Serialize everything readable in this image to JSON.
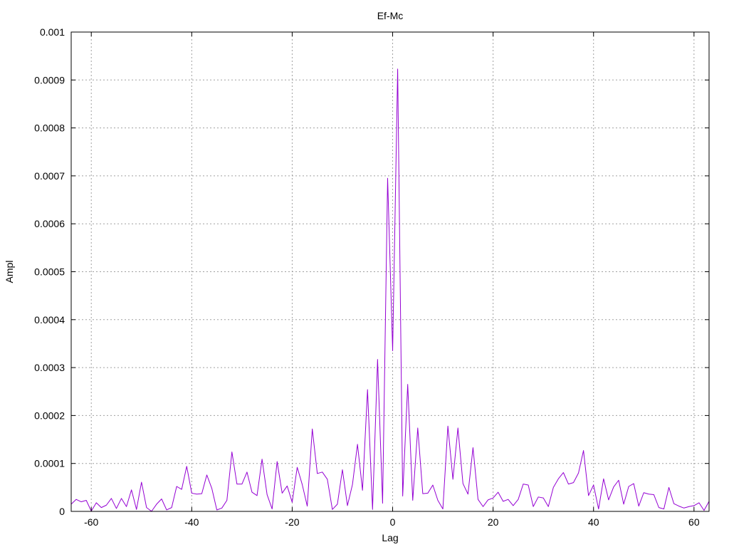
{
  "chart_data": {
    "type": "line",
    "title": "Ef-Mc",
    "xlabel": "Lag",
    "ylabel": "Ampl",
    "xlim": [
      -64,
      63
    ],
    "ylim": [
      0,
      0.001
    ],
    "grid": true,
    "x_ticks": [
      -60,
      -40,
      -20,
      0,
      20,
      40,
      60
    ],
    "x_tick_labels": [
      "-60",
      "-40",
      "-20",
      "0",
      "20",
      "40",
      "60"
    ],
    "y_ticks": [
      0,
      0.0001,
      0.0002,
      0.0003,
      0.0004,
      0.0005,
      0.0006,
      0.0007,
      0.0008,
      0.0009,
      0.001
    ],
    "y_tick_labels": [
      "0",
      "0.0001",
      "0.0002",
      "0.0003",
      "0.0004",
      "0.0005",
      "0.0006",
      "0.0007",
      "0.0008",
      "0.0009",
      "0.001"
    ],
    "series": [
      {
        "color": "#9400d3",
        "x": [
          -64,
          -63,
          -62,
          -61,
          -60,
          -59,
          -58,
          -57,
          -56,
          -55,
          -54,
          -53,
          -52,
          -51,
          -50,
          -49,
          -48,
          -47,
          -46,
          -45,
          -44,
          -43,
          -42,
          -41,
          -40,
          -39,
          -38,
          -37,
          -36,
          -35,
          -34,
          -33,
          -32,
          -31,
          -30,
          -29,
          -28,
          -27,
          -26,
          -25,
          -24,
          -23,
          -22,
          -21,
          -20,
          -19,
          -18,
          -17,
          -16,
          -15,
          -14,
          -13,
          -12,
          -11,
          -10,
          -9,
          -8,
          -7,
          -6,
          -5,
          -4,
          -3,
          -2,
          -1,
          0,
          1,
          2,
          3,
          4,
          5,
          6,
          7,
          8,
          9,
          10,
          11,
          12,
          13,
          14,
          15,
          16,
          17,
          18,
          19,
          20,
          21,
          22,
          23,
          24,
          25,
          26,
          27,
          28,
          29,
          30,
          31,
          32,
          33,
          34,
          35,
          36,
          37,
          38,
          39,
          40,
          41,
          42,
          43,
          44,
          45,
          46,
          47,
          48,
          49,
          50,
          51,
          52,
          53,
          54,
          55,
          56,
          57,
          58,
          59,
          60,
          61,
          62,
          63
        ],
        "y": [
          1.5e-05,
          2.5e-05,
          2e-05,
          2.3e-05,
          5e-07,
          1.8e-05,
          8e-06,
          1.3e-05,
          2.7e-05,
          6e-06,
          2.7e-05,
          1e-05,
          4.5e-05,
          4e-06,
          6.1e-05,
          8e-06,
          2e-07,
          1.5e-05,
          2.6e-05,
          3e-06,
          8e-06,
          5.2e-05,
          4.6e-05,
          9.4e-05,
          3.8e-05,
          3.6e-05,
          3.7e-05,
          7.6e-05,
          4.8e-05,
          3e-06,
          7e-06,
          2.3e-05,
          0.000124,
          5.7e-05,
          5.7e-05,
          8.2e-05,
          4e-05,
          3.3e-05,
          0.000109,
          3.5e-05,
          5e-06,
          0.000104,
          3.8e-05,
          5.3e-05,
          1.9e-05,
          9.2e-05,
          5.6e-05,
          1.1e-05,
          0.000172,
          7.9e-05,
          8.2e-05,
          6.7e-05,
          4e-06,
          1.5e-05,
          8.7e-05,
          1.2e-05,
          5.6e-05,
          0.00014,
          4.4e-05,
          0.000254,
          4e-06,
          0.000317,
          1.7e-05,
          0.000695,
          0.000335,
          0.000923,
          3.2e-05,
          0.000265,
          2.3e-05,
          0.000174,
          3.7e-05,
          3.8e-05,
          5.5e-05,
          2.3e-05,
          5e-06,
          0.000178,
          6.7e-05,
          0.000174,
          5.8e-05,
          3.6e-05,
          0.000133,
          2.5e-05,
          1e-05,
          2.4e-05,
          2.8e-05,
          4e-05,
          2.1e-05,
          2.5e-05,
          1.2e-05,
          2.5e-05,
          5.7e-05,
          5.5e-05,
          1e-05,
          3e-05,
          2.8e-05,
          1e-05,
          5e-05,
          6.8e-05,
          8.1e-05,
          5.7e-05,
          6e-05,
          8e-05,
          0.000127,
          3.3e-05,
          5.5e-05,
          5e-06,
          6.8e-05,
          2.4e-05,
          5.1e-05,
          6.5e-05,
          1.5e-05,
          5.2e-05,
          5.8e-05,
          1.1e-05,
          3.9e-05,
          3.6e-05,
          3.5e-05,
          8e-06,
          5e-06,
          5e-05,
          1.6e-05,
          1.1e-05,
          7e-06,
          1e-05,
          1.2e-05,
          1.8e-05,
          2e-06,
          2.1e-05
        ]
      }
    ]
  }
}
